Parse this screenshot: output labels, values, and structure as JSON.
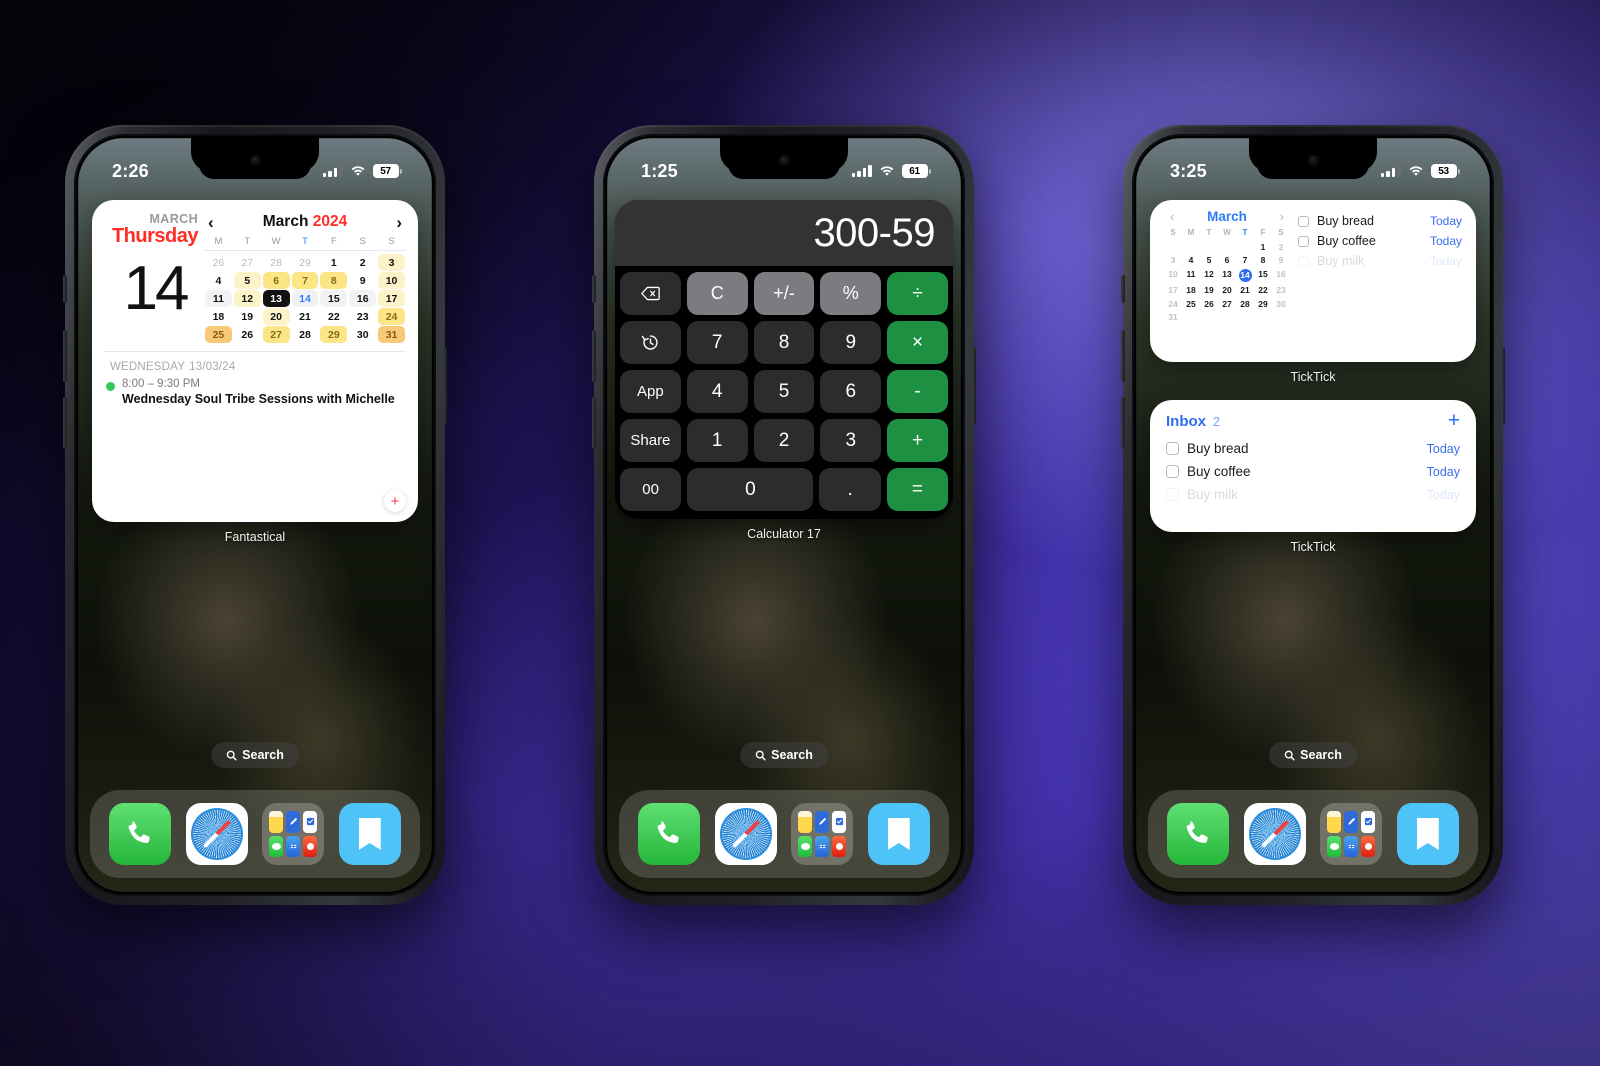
{
  "background": {
    "accent": "#6f5cf0",
    "dark": "#05040e"
  },
  "phones": [
    {
      "id": "phone-fantastical",
      "status": {
        "time": "2:26",
        "battery": "57",
        "wifi": "wifi-icon",
        "cellular": "cellular-bars-icon"
      },
      "widget_label": "Fantastical",
      "search_label": "Search"
    },
    {
      "id": "phone-calculator",
      "status": {
        "time": "1:25",
        "battery": "61",
        "wifi": "wifi-icon",
        "cellular": "cellular-bars-icon"
      },
      "widget_label": "Calculator 17",
      "search_label": "Search"
    },
    {
      "id": "phone-ticktick",
      "status": {
        "time": "3:25",
        "battery": "53",
        "wifi": "wifi-icon",
        "cellular": "cellular-bars-icon"
      },
      "widget_label_top": "TickTick",
      "widget_label_bottom": "TickTick",
      "search_label": "Search"
    }
  ],
  "fantastical": {
    "month_label": "MARCH",
    "weekday": "Thursday",
    "day_number": "14",
    "nav": {
      "prev": "‹",
      "title_month": "March",
      "title_year": "2024",
      "next": "›"
    },
    "weekday_headers": [
      "M",
      "T",
      "W",
      "T",
      "F",
      "S",
      "S"
    ],
    "highlight_header_index": 3,
    "weeks": [
      [
        {
          "d": "26",
          "state": "muted"
        },
        {
          "d": "27",
          "state": "muted"
        },
        {
          "d": "28",
          "state": "muted"
        },
        {
          "d": "29",
          "state": "muted"
        },
        {
          "d": "1",
          "state": "normal"
        },
        {
          "d": "2",
          "state": "normal"
        },
        {
          "d": "3",
          "state": "normal",
          "heat": 1
        }
      ],
      [
        {
          "d": "4",
          "state": "normal"
        },
        {
          "d": "5",
          "state": "normal",
          "heat": 1
        },
        {
          "d": "6",
          "state": "normal",
          "heat": 2
        },
        {
          "d": "7",
          "state": "normal",
          "heat": 2
        },
        {
          "d": "8",
          "state": "normal",
          "heat": 2
        },
        {
          "d": "9",
          "state": "normal"
        },
        {
          "d": "10",
          "state": "normal",
          "heat": 1
        }
      ],
      [
        {
          "d": "11",
          "state": "normal"
        },
        {
          "d": "12",
          "state": "normal",
          "heat": 1
        },
        {
          "d": "13",
          "state": "today"
        },
        {
          "d": "14",
          "state": "tomorrow"
        },
        {
          "d": "15",
          "state": "normal"
        },
        {
          "d": "16",
          "state": "normal"
        },
        {
          "d": "17",
          "state": "normal",
          "heat": 1
        }
      ],
      [
        {
          "d": "18",
          "state": "normal"
        },
        {
          "d": "19",
          "state": "normal"
        },
        {
          "d": "20",
          "state": "normal",
          "heat": 1
        },
        {
          "d": "21",
          "state": "normal"
        },
        {
          "d": "22",
          "state": "normal"
        },
        {
          "d": "23",
          "state": "normal"
        },
        {
          "d": "24",
          "state": "normal",
          "heat": 2
        }
      ],
      [
        {
          "d": "25",
          "state": "normal",
          "heat": 3
        },
        {
          "d": "26",
          "state": "normal"
        },
        {
          "d": "27",
          "state": "normal",
          "heat": 2
        },
        {
          "d": "28",
          "state": "normal"
        },
        {
          "d": "29",
          "state": "normal",
          "heat": 2
        },
        {
          "d": "30",
          "state": "normal"
        },
        {
          "d": "31",
          "state": "normal",
          "heat": 3
        }
      ]
    ],
    "highlight_row_index": 2,
    "event": {
      "day_label": "WEDNESDAY",
      "date_label": "13/03/24",
      "time": "8:00 – 9:30 PM",
      "title": "Wednesday Soul Tribe Sessions with Michelle",
      "dot_color": "#34c759"
    },
    "add_button": "+"
  },
  "calculator": {
    "display": "300-59",
    "rows": [
      [
        {
          "label": "",
          "icon": "backspace-icon",
          "type": "dark",
          "name": "backspace-key"
        },
        {
          "label": "C",
          "type": "fn",
          "name": "clear-key"
        },
        {
          "label": "+/-",
          "type": "fn",
          "name": "plus-minus-key"
        },
        {
          "label": "%",
          "type": "fn",
          "name": "percent-key"
        },
        {
          "label": "÷",
          "type": "op",
          "name": "divide-key"
        }
      ],
      [
        {
          "label": "",
          "icon": "history-icon",
          "type": "dark",
          "name": "history-key"
        },
        {
          "label": "7",
          "type": "num",
          "name": "seven-key"
        },
        {
          "label": "8",
          "type": "num",
          "name": "eight-key"
        },
        {
          "label": "9",
          "type": "num",
          "name": "nine-key"
        },
        {
          "label": "×",
          "type": "op",
          "name": "multiply-key"
        }
      ],
      [
        {
          "label": "App",
          "type": "dark",
          "name": "app-key"
        },
        {
          "label": "4",
          "type": "num",
          "name": "four-key"
        },
        {
          "label": "5",
          "type": "num",
          "name": "five-key"
        },
        {
          "label": "6",
          "type": "num",
          "name": "six-key"
        },
        {
          "label": "-",
          "type": "op",
          "name": "minus-key"
        }
      ],
      [
        {
          "label": "Share",
          "type": "dark",
          "name": "share-key"
        },
        {
          "label": "1",
          "type": "num",
          "name": "one-key"
        },
        {
          "label": "2",
          "type": "num",
          "name": "two-key"
        },
        {
          "label": "3",
          "type": "num",
          "name": "three-key"
        },
        {
          "label": "+",
          "type": "op",
          "name": "plus-key"
        }
      ],
      [
        {
          "label": "00",
          "type": "dark",
          "name": "double-zero-key"
        },
        {
          "label": "0",
          "type": "num",
          "wide": true,
          "name": "zero-key"
        },
        {
          "label": ".",
          "type": "num",
          "name": "decimal-key"
        },
        {
          "label": "=",
          "type": "op",
          "name": "equals-key"
        }
      ]
    ]
  },
  "ticktick_calendar": {
    "nav": {
      "prev": "‹",
      "month": "March",
      "next": "›"
    },
    "weekday_headers": [
      "S",
      "M",
      "T",
      "W",
      "T",
      "F",
      "S"
    ],
    "highlight_header_index": 4,
    "weeks": [
      [
        {
          "d": "",
          "state": "blank"
        },
        {
          "d": "",
          "state": "blank"
        },
        {
          "d": "",
          "state": "blank"
        },
        {
          "d": "",
          "state": "blank"
        },
        {
          "d": "",
          "state": "blank"
        },
        {
          "d": "1",
          "state": "normal"
        },
        {
          "d": "2",
          "state": "weekend"
        }
      ],
      [
        {
          "d": "3",
          "state": "weekend"
        },
        {
          "d": "4",
          "state": "normal"
        },
        {
          "d": "5",
          "state": "normal"
        },
        {
          "d": "6",
          "state": "normal"
        },
        {
          "d": "7",
          "state": "normal"
        },
        {
          "d": "8",
          "state": "normal"
        },
        {
          "d": "9",
          "state": "weekend"
        }
      ],
      [
        {
          "d": "10",
          "state": "weekend"
        },
        {
          "d": "11",
          "state": "normal"
        },
        {
          "d": "12",
          "state": "normal"
        },
        {
          "d": "13",
          "state": "normal"
        },
        {
          "d": "14",
          "state": "selected"
        },
        {
          "d": "15",
          "state": "normal"
        },
        {
          "d": "16",
          "state": "weekend"
        }
      ],
      [
        {
          "d": "17",
          "state": "weekend"
        },
        {
          "d": "18",
          "state": "normal"
        },
        {
          "d": "19",
          "state": "normal"
        },
        {
          "d": "20",
          "state": "normal"
        },
        {
          "d": "21",
          "state": "normal"
        },
        {
          "d": "22",
          "state": "normal"
        },
        {
          "d": "23",
          "state": "weekend"
        }
      ],
      [
        {
          "d": "24",
          "state": "weekend"
        },
        {
          "d": "25",
          "state": "normal"
        },
        {
          "d": "26",
          "state": "normal"
        },
        {
          "d": "27",
          "state": "normal"
        },
        {
          "d": "28",
          "state": "normal"
        },
        {
          "d": "29",
          "state": "normal"
        },
        {
          "d": "30",
          "state": "weekend"
        }
      ],
      [
        {
          "d": "31",
          "state": "weekend"
        },
        {
          "d": "",
          "state": "blank"
        },
        {
          "d": "",
          "state": "blank"
        },
        {
          "d": "",
          "state": "blank"
        },
        {
          "d": "",
          "state": "blank"
        },
        {
          "d": "",
          "state": "blank"
        },
        {
          "d": "",
          "state": "blank"
        }
      ]
    ],
    "tasks": [
      {
        "title": "Buy bread",
        "when": "Today",
        "faded": false
      },
      {
        "title": "Buy coffee",
        "when": "Today",
        "faded": false
      },
      {
        "title": "Buy milk",
        "when": "Today",
        "faded": true
      }
    ]
  },
  "ticktick_inbox": {
    "title": "Inbox",
    "count": "2",
    "add": "+",
    "tasks": [
      {
        "title": "Buy bread",
        "when": "Today",
        "faded": false
      },
      {
        "title": "Buy coffee",
        "when": "Today",
        "faded": false
      },
      {
        "title": "Buy milk",
        "when": "Today",
        "faded": true
      }
    ]
  },
  "dock": {
    "apps": [
      {
        "name": "phone-app",
        "label": "Phone"
      },
      {
        "name": "safari-app",
        "label": "Safari"
      },
      {
        "name": "folder-app",
        "label": "Folder"
      },
      {
        "name": "bookmarks-app",
        "label": "Bookmarks"
      }
    ]
  }
}
